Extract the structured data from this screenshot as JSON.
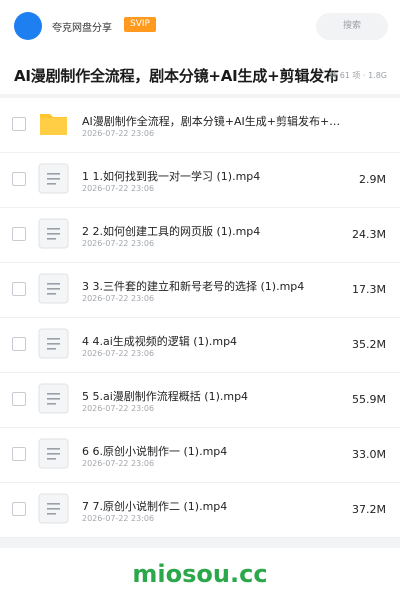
{
  "header": {
    "brand": "夸克网盘分享",
    "badge": "SVIP",
    "search_placeholder": "搜索"
  },
  "page": {
    "title": "AI漫剧制作全流程，剧本分镜+AI生成+剪辑发布",
    "meta": "共 61 项 · 1.8G"
  },
  "files": [
    {
      "type": "folder",
      "name": "AI漫剧制作全流程，剧本分镜+AI生成+剪辑发布+…",
      "date": "2026-07-22 23:06",
      "size": ""
    },
    {
      "type": "file",
      "name": "1 1.如何找到我一对一学习 (1).mp4",
      "date": "2026-07-22 23:06",
      "size": "2.9M"
    },
    {
      "type": "file",
      "name": "2 2.如何创建工具的网页版 (1).mp4",
      "date": "2026-07-22 23:06",
      "size": "24.3M"
    },
    {
      "type": "file",
      "name": "3 3.三件套的建立和新号老号的选择 (1).mp4",
      "date": "2026-07-22 23:06",
      "size": "17.3M"
    },
    {
      "type": "file",
      "name": "4 4.ai生成视频的逻辑 (1).mp4",
      "date": "2026-07-22 23:06",
      "size": "35.2M"
    },
    {
      "type": "file",
      "name": "5 5.ai漫剧制作流程概括 (1).mp4",
      "date": "2026-07-22 23:06",
      "size": "55.9M"
    },
    {
      "type": "file",
      "name": "6 6.原创小说制作一 (1).mp4",
      "date": "2026-07-22 23:06",
      "size": "33.0M"
    },
    {
      "type": "file",
      "name": "7 7.原创小说制作二 (1).mp4",
      "date": "2026-07-22 23:06",
      "size": "37.2M"
    }
  ],
  "footer": {
    "watermark": "miosou.cc"
  },
  "colors": {
    "accent": "#1e7ff0",
    "badge": "#ff9a1f",
    "folder": "#ffc530",
    "watermark": "#2aa84a"
  },
  "icons": {
    "folder": "folder-icon",
    "file": "document-icon"
  }
}
